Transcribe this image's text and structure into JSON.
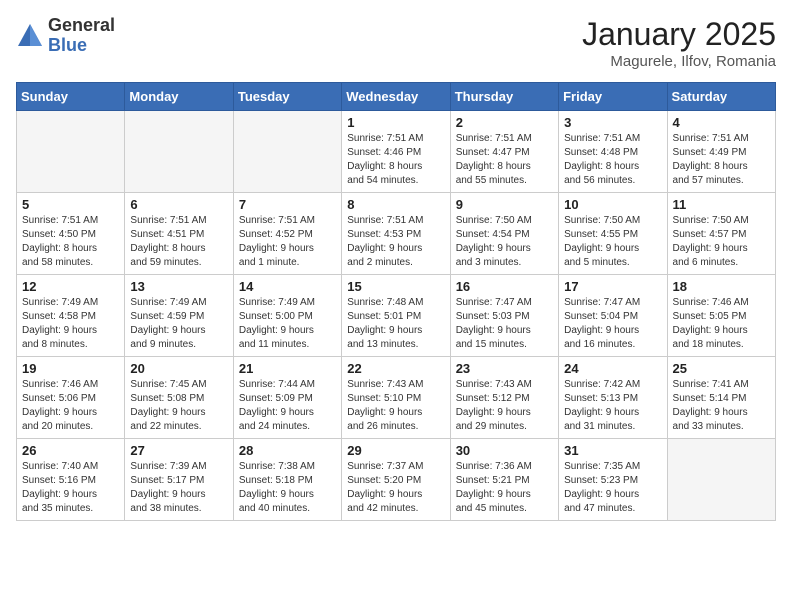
{
  "logo": {
    "general": "General",
    "blue": "Blue"
  },
  "title": "January 2025",
  "subtitle": "Magurele, Ilfov, Romania",
  "weekdays": [
    "Sunday",
    "Monday",
    "Tuesday",
    "Wednesday",
    "Thursday",
    "Friday",
    "Saturday"
  ],
  "weeks": [
    [
      {
        "day": "",
        "info": "",
        "empty": true
      },
      {
        "day": "",
        "info": "",
        "empty": true
      },
      {
        "day": "",
        "info": "",
        "empty": true
      },
      {
        "day": "1",
        "info": "Sunrise: 7:51 AM\nSunset: 4:46 PM\nDaylight: 8 hours\nand 54 minutes."
      },
      {
        "day": "2",
        "info": "Sunrise: 7:51 AM\nSunset: 4:47 PM\nDaylight: 8 hours\nand 55 minutes."
      },
      {
        "day": "3",
        "info": "Sunrise: 7:51 AM\nSunset: 4:48 PM\nDaylight: 8 hours\nand 56 minutes."
      },
      {
        "day": "4",
        "info": "Sunrise: 7:51 AM\nSunset: 4:49 PM\nDaylight: 8 hours\nand 57 minutes."
      }
    ],
    [
      {
        "day": "5",
        "info": "Sunrise: 7:51 AM\nSunset: 4:50 PM\nDaylight: 8 hours\nand 58 minutes."
      },
      {
        "day": "6",
        "info": "Sunrise: 7:51 AM\nSunset: 4:51 PM\nDaylight: 8 hours\nand 59 minutes."
      },
      {
        "day": "7",
        "info": "Sunrise: 7:51 AM\nSunset: 4:52 PM\nDaylight: 9 hours\nand 1 minute."
      },
      {
        "day": "8",
        "info": "Sunrise: 7:51 AM\nSunset: 4:53 PM\nDaylight: 9 hours\nand 2 minutes."
      },
      {
        "day": "9",
        "info": "Sunrise: 7:50 AM\nSunset: 4:54 PM\nDaylight: 9 hours\nand 3 minutes."
      },
      {
        "day": "10",
        "info": "Sunrise: 7:50 AM\nSunset: 4:55 PM\nDaylight: 9 hours\nand 5 minutes."
      },
      {
        "day": "11",
        "info": "Sunrise: 7:50 AM\nSunset: 4:57 PM\nDaylight: 9 hours\nand 6 minutes."
      }
    ],
    [
      {
        "day": "12",
        "info": "Sunrise: 7:49 AM\nSunset: 4:58 PM\nDaylight: 9 hours\nand 8 minutes."
      },
      {
        "day": "13",
        "info": "Sunrise: 7:49 AM\nSunset: 4:59 PM\nDaylight: 9 hours\nand 9 minutes."
      },
      {
        "day": "14",
        "info": "Sunrise: 7:49 AM\nSunset: 5:00 PM\nDaylight: 9 hours\nand 11 minutes."
      },
      {
        "day": "15",
        "info": "Sunrise: 7:48 AM\nSunset: 5:01 PM\nDaylight: 9 hours\nand 13 minutes."
      },
      {
        "day": "16",
        "info": "Sunrise: 7:47 AM\nSunset: 5:03 PM\nDaylight: 9 hours\nand 15 minutes."
      },
      {
        "day": "17",
        "info": "Sunrise: 7:47 AM\nSunset: 5:04 PM\nDaylight: 9 hours\nand 16 minutes."
      },
      {
        "day": "18",
        "info": "Sunrise: 7:46 AM\nSunset: 5:05 PM\nDaylight: 9 hours\nand 18 minutes."
      }
    ],
    [
      {
        "day": "19",
        "info": "Sunrise: 7:46 AM\nSunset: 5:06 PM\nDaylight: 9 hours\nand 20 minutes."
      },
      {
        "day": "20",
        "info": "Sunrise: 7:45 AM\nSunset: 5:08 PM\nDaylight: 9 hours\nand 22 minutes."
      },
      {
        "day": "21",
        "info": "Sunrise: 7:44 AM\nSunset: 5:09 PM\nDaylight: 9 hours\nand 24 minutes."
      },
      {
        "day": "22",
        "info": "Sunrise: 7:43 AM\nSunset: 5:10 PM\nDaylight: 9 hours\nand 26 minutes."
      },
      {
        "day": "23",
        "info": "Sunrise: 7:43 AM\nSunset: 5:12 PM\nDaylight: 9 hours\nand 29 minutes."
      },
      {
        "day": "24",
        "info": "Sunrise: 7:42 AM\nSunset: 5:13 PM\nDaylight: 9 hours\nand 31 minutes."
      },
      {
        "day": "25",
        "info": "Sunrise: 7:41 AM\nSunset: 5:14 PM\nDaylight: 9 hours\nand 33 minutes."
      }
    ],
    [
      {
        "day": "26",
        "info": "Sunrise: 7:40 AM\nSunset: 5:16 PM\nDaylight: 9 hours\nand 35 minutes."
      },
      {
        "day": "27",
        "info": "Sunrise: 7:39 AM\nSunset: 5:17 PM\nDaylight: 9 hours\nand 38 minutes."
      },
      {
        "day": "28",
        "info": "Sunrise: 7:38 AM\nSunset: 5:18 PM\nDaylight: 9 hours\nand 40 minutes."
      },
      {
        "day": "29",
        "info": "Sunrise: 7:37 AM\nSunset: 5:20 PM\nDaylight: 9 hours\nand 42 minutes."
      },
      {
        "day": "30",
        "info": "Sunrise: 7:36 AM\nSunset: 5:21 PM\nDaylight: 9 hours\nand 45 minutes."
      },
      {
        "day": "31",
        "info": "Sunrise: 7:35 AM\nSunset: 5:23 PM\nDaylight: 9 hours\nand 47 minutes."
      },
      {
        "day": "",
        "info": "",
        "empty": true
      }
    ]
  ]
}
